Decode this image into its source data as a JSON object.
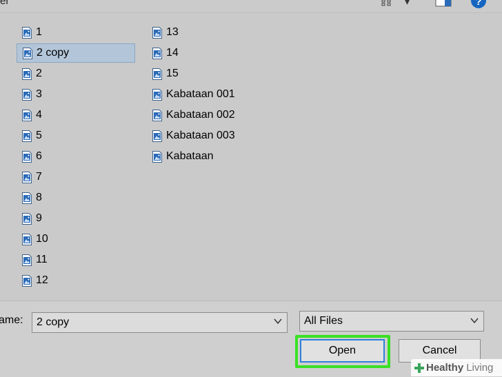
{
  "dialog": {
    "title_fragment": "er"
  },
  "files": {
    "column_1": [
      "1",
      "2 copy",
      "2",
      "3",
      "4",
      "5",
      "6",
      "7",
      "8",
      "9",
      "10",
      "11",
      "12"
    ],
    "column_2": [
      "13",
      "14",
      "15",
      "Kabataan 001",
      "Kabataan 002",
      "Kabataan 003",
      "Kabataan"
    ],
    "selected": "2 copy"
  },
  "bottom": {
    "filename_label": "ame:",
    "filename_value": "2 copy",
    "filetype_value": "All Files",
    "open_label": "Open",
    "cancel_label": "Cancel"
  },
  "watermark": {
    "brand_bold": "Healthy",
    "brand_light": "Living"
  },
  "colors": {
    "selection_bg": "#b3c6d9",
    "highlight_green": "#39e024",
    "help_blue": "#1565c0",
    "icon_blue": "#2a6ab8"
  },
  "icons": {
    "file": "image-file-icon",
    "view": "view-options-icon",
    "pane": "preview-pane-icon",
    "help": "help-icon"
  }
}
